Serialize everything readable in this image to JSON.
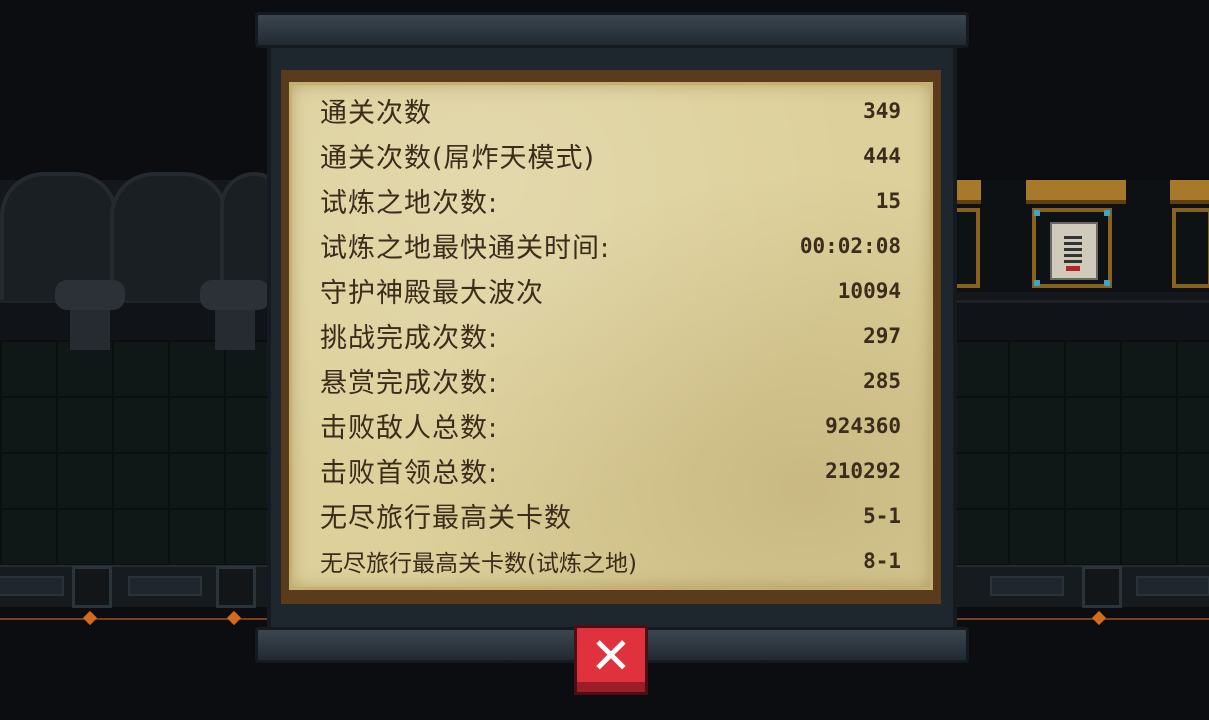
{
  "stats": [
    {
      "label": "通关次数",
      "value": "349"
    },
    {
      "label": "通关次数(屌炸天模式)",
      "value": "444"
    },
    {
      "label": "试炼之地次数:",
      "value": "15"
    },
    {
      "label": "试炼之地最快通关时间:",
      "value": "00:02:08"
    },
    {
      "label": "守护神殿最大波次",
      "value": "10094"
    },
    {
      "label": "挑战完成次数:",
      "value": "297"
    },
    {
      "label": "悬赏完成次数:",
      "value": "285"
    },
    {
      "label": "击败敌人总数:",
      "value": "924360"
    },
    {
      "label": "击败首领总数:",
      "value": "210292"
    },
    {
      "label": "无尽旅行最高关卡数",
      "value": "5-1"
    },
    {
      "label": "无尽旅行最高关卡数(试炼之地)",
      "value": "8-1"
    }
  ],
  "close_button": {
    "glyph": "✕",
    "icon": "close-icon",
    "color": "#e0323c"
  },
  "colors": {
    "paper": "#ddd09a",
    "text": "#3c2c1c",
    "accent": "#d86a1c"
  }
}
